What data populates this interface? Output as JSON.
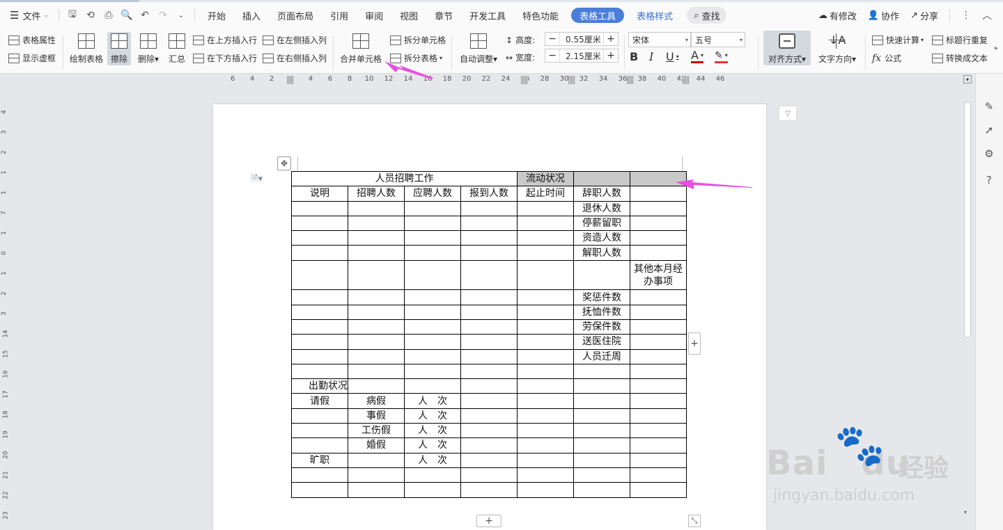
{
  "menubar": {
    "file_label": "文件",
    "tabs": [
      "开始",
      "插入",
      "页面布局",
      "引用",
      "审阅",
      "视图",
      "章节",
      "开发工具",
      "特色功能"
    ],
    "active_tab": "表格工具",
    "extra_tab": "表格样式",
    "search_label": "查找",
    "right": {
      "modified": "有修改",
      "collab": "协作",
      "share": "分享"
    }
  },
  "ribbon": {
    "table_props": "表格属性",
    "show_gridlines": "显示虚框",
    "draw_table": "绘制表格",
    "erase": "擦除",
    "delete": "删除",
    "summary": "汇总",
    "insert_above": "在上方插入行",
    "insert_below": "在下方插入行",
    "insert_left": "在左侧插入列",
    "insert_right": "在右侧插入列",
    "merge_cells": "合并单元格",
    "split_cells": "拆分单元格",
    "split_table": "拆分表格",
    "auto_adjust": "自动调整",
    "height_label": "高度:",
    "height_value": "0.55厘米",
    "width_label": "宽度:",
    "width_value": "2.15厘米",
    "font_name": "宋体",
    "font_size": "五号",
    "align": "对齐方式",
    "text_direction": "文字方向",
    "quick_calc": "快速计算",
    "header_repeat": "标题行重复",
    "formula": "公式",
    "convert_text": "转换成文本"
  },
  "ruler": {
    "h_labels": [
      "6",
      "4",
      "2",
      "2",
      "4",
      "6",
      "8",
      "10",
      "12",
      "14",
      "16",
      "18",
      "20",
      "22",
      "24",
      "26",
      "28",
      "30",
      "32",
      "34",
      "36",
      "38",
      "40",
      "42",
      "44",
      "46"
    ],
    "v_labels": [
      "4",
      "3",
      "2",
      "1",
      "1",
      "7",
      "1",
      "0",
      "1",
      "2",
      "3",
      "14",
      "15",
      "16",
      "17",
      "18",
      "19",
      "20",
      "21",
      "22",
      "23"
    ]
  },
  "table": {
    "rows": [
      [
        "人员招聘工作",
        "",
        "",
        "",
        "流动状况",
        "",
        ""
      ],
      [
        "说明",
        "招聘人数",
        "应聘人数",
        "报到人数",
        "起止时间",
        "辞职人数",
        ""
      ],
      [
        "",
        "",
        "",
        "",
        "",
        "退休人数",
        ""
      ],
      [
        "",
        "",
        "",
        "",
        "",
        "停薪留职",
        ""
      ],
      [
        "",
        "",
        "",
        "",
        "",
        "资造人数",
        ""
      ],
      [
        "",
        "",
        "",
        "",
        "",
        "解职人数",
        ""
      ],
      [
        "",
        "",
        "",
        "",
        "",
        "",
        "其他本月经办事项"
      ],
      [
        "",
        "",
        "",
        "",
        "",
        "奖惩件数",
        ""
      ],
      [
        "",
        "",
        "",
        "",
        "",
        "抚恤件数",
        ""
      ],
      [
        "",
        "",
        "",
        "",
        "",
        "劳保件数",
        ""
      ],
      [
        "",
        "",
        "",
        "",
        "",
        "送医住院",
        ""
      ],
      [
        "",
        "",
        "",
        "",
        "",
        "人员迁周",
        ""
      ],
      [
        "",
        "",
        "",
        "",
        "",
        "",
        ""
      ],
      [
        "出勤状况",
        "",
        "",
        "",
        "",
        "",
        ""
      ],
      [
        "请假",
        "病假",
        "人　次",
        "",
        "",
        "",
        ""
      ],
      [
        "",
        "事假",
        "人　次",
        "",
        "",
        "",
        ""
      ],
      [
        "",
        "工伤假",
        "人　次",
        "",
        "",
        "",
        ""
      ],
      [
        "",
        "婚假",
        "人　次",
        "",
        "",
        "",
        ""
      ],
      [
        "旷职",
        "",
        "人　次",
        "",
        "",
        "",
        ""
      ],
      [
        "",
        "",
        "",
        "",
        "",
        "",
        ""
      ],
      [
        "",
        "",
        "",
        "",
        "",
        "",
        ""
      ]
    ]
  },
  "watermark": {
    "brand": "Bai",
    "brand2": "du",
    "cn": "经验",
    "url": "jingyan.baidu.com"
  },
  "colors": {
    "accent": "#4a7fd9",
    "arrow": "#e84fe0",
    "shade": "#c9c9c9"
  },
  "icons": [
    "menu-icon",
    "save-icon",
    "print-icon",
    "preview-icon",
    "undo-icon",
    "redo-icon",
    "search-icon",
    "cloud-icon",
    "user-icon",
    "share-icon",
    "more-icon",
    "collapse-icon",
    "pen-icon",
    "cursor-icon",
    "settings-icon",
    "help-icon"
  ]
}
